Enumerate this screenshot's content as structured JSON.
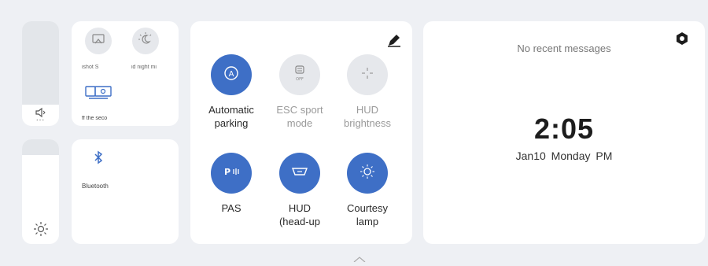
{
  "colors": {
    "background": "#eef0f4",
    "card": "#ffffff",
    "active_blue": "#3e6fc6",
    "inactive_grey": "#e6e8ec"
  },
  "volume": {
    "icon": "speaker-icon",
    "dots": "...",
    "level_percent": 80
  },
  "brightness": {
    "icon": "sun-icon",
    "level_percent": 15
  },
  "quick_tiles": [
    {
      "label": "ishot S",
      "icon": "screenshot-icon"
    },
    {
      "label": "id night mi",
      "icon": "night-mode-icon"
    },
    {
      "label": "ff the seco",
      "icon": "second-screen-icon"
    }
  ],
  "bluetooth": {
    "label": "Bluetooth",
    "icon": "bluetooth-icon"
  },
  "controls": [
    {
      "line1": "Automatic",
      "line2": "parking",
      "state": "on",
      "icon": "parking-assist-icon"
    },
    {
      "line1": "ESC sport",
      "line2": "mode",
      "state": "off",
      "icon": "esc-off-icon",
      "badge": "OFF"
    },
    {
      "line1": "HUD",
      "line2": "brightness",
      "state": "off",
      "icon": "hud-brightness-icon"
    },
    {
      "line1": "PAS",
      "line2": "",
      "state": "on",
      "icon": "pas-icon",
      "badge": "P"
    },
    {
      "line1": "HUD",
      "line2": "(head-up",
      "state": "on",
      "icon": "hud-icon"
    },
    {
      "line1": "Courtesy",
      "line2": "lamp",
      "state": "on",
      "icon": "courtesy-lamp-icon"
    }
  ],
  "edit_icon": "pencil-icon",
  "messages": {
    "empty_text": "No recent messages",
    "settings_icon": "hexagon-settings-icon"
  },
  "clock": {
    "time": "2:05",
    "date": "Jan10",
    "weekday": "Monday",
    "ampm": "PM"
  }
}
